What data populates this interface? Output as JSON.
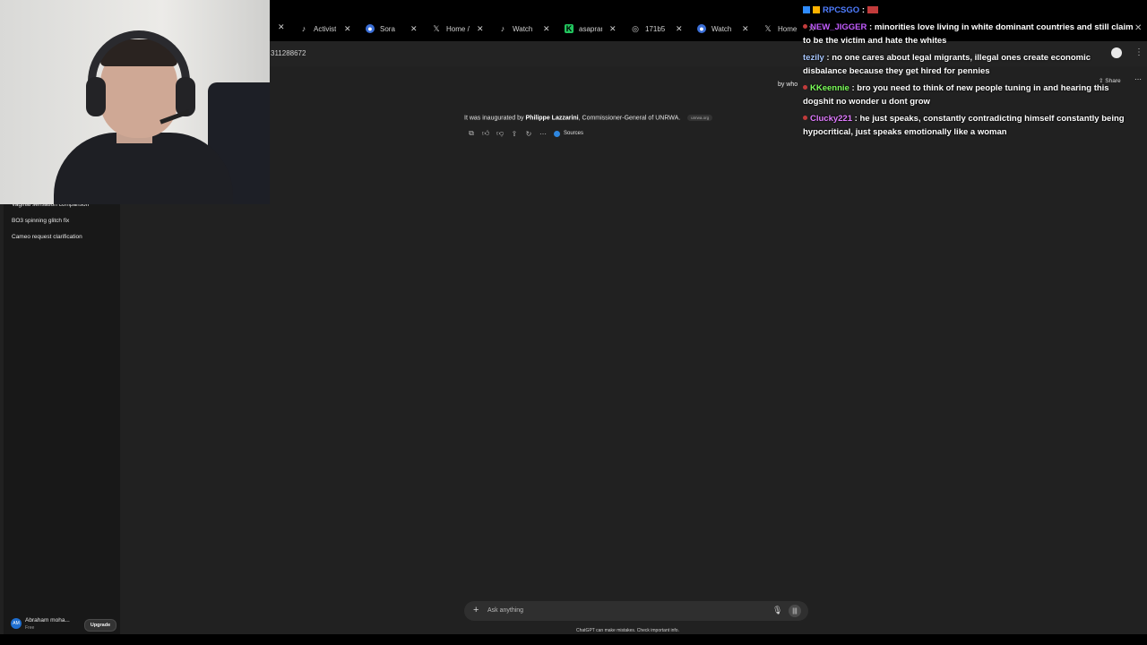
{
  "tabs": [
    {
      "label": "Activist",
      "icon": "tiktok-icon"
    },
    {
      "label": "Sora",
      "icon": "sora-icon"
    },
    {
      "label": "Home /",
      "icon": "x-icon"
    },
    {
      "label": "Watch",
      "icon": "tiktok-icon"
    },
    {
      "label": "asapran",
      "icon": "kick-icon"
    },
    {
      "label": "171b5",
      "icon": "globe-icon"
    },
    {
      "label": "Watch",
      "icon": "sora-icon"
    },
    {
      "label": "Home",
      "icon": "x-icon"
    }
  ],
  "address_bar": {
    "url_fragment": "311288672"
  },
  "sidebar": {
    "items": [
      {
        "label": "Vaginal sensation comparison"
      },
      {
        "label": "BO3 spinning glitch fix"
      },
      {
        "label": "Cameo request clarification"
      }
    ],
    "user": {
      "initials": "AM",
      "name": "Abraham moha...",
      "plan": "Free",
      "upgrade_label": "Upgrade"
    }
  },
  "conversation": {
    "user_message": "by who",
    "answer_prefix": "It was inaugurated by ",
    "answer_bold": "Philippe Lazzarini",
    "answer_suffix": ", Commissioner-General of UNRWA.",
    "source_chip": "unrwa.org",
    "sources_label": "Sources",
    "share_label": "Share"
  },
  "composer": {
    "placeholder": "Ask anything",
    "disclaimer": "ChatGPT can make mistakes. Check important info."
  },
  "stream_chat": [
    {
      "user": "RPCSGO",
      "user_color": "#4f7dff",
      "text": ""
    },
    {
      "user": "NEW_JIGGER",
      "user_color": "#c35cff",
      "text": "minorities love living in white dominant countries and still claim to be the victim and hate the whites"
    },
    {
      "user": "tezily",
      "user_color": "#a9c8ff",
      "text": "no one cares about legal migrants, illegal ones create economic disbalance because they get hired for pennies"
    },
    {
      "user": "KKeennie",
      "user_color": "#7cff5a",
      "text": "bro you need to think of new people tuning in and hearing this dogshit no wonder u dont grow"
    },
    {
      "user": "Clucky221",
      "user_color": "#e17cff",
      "text": "he just speaks, constantly contradicting himself constantly being hypocritical, just speaks emotionally like a woman"
    }
  ],
  "colors": {
    "app_bg": "#212121",
    "sidebar_bg": "#181818",
    "accent": "#2e86de"
  }
}
